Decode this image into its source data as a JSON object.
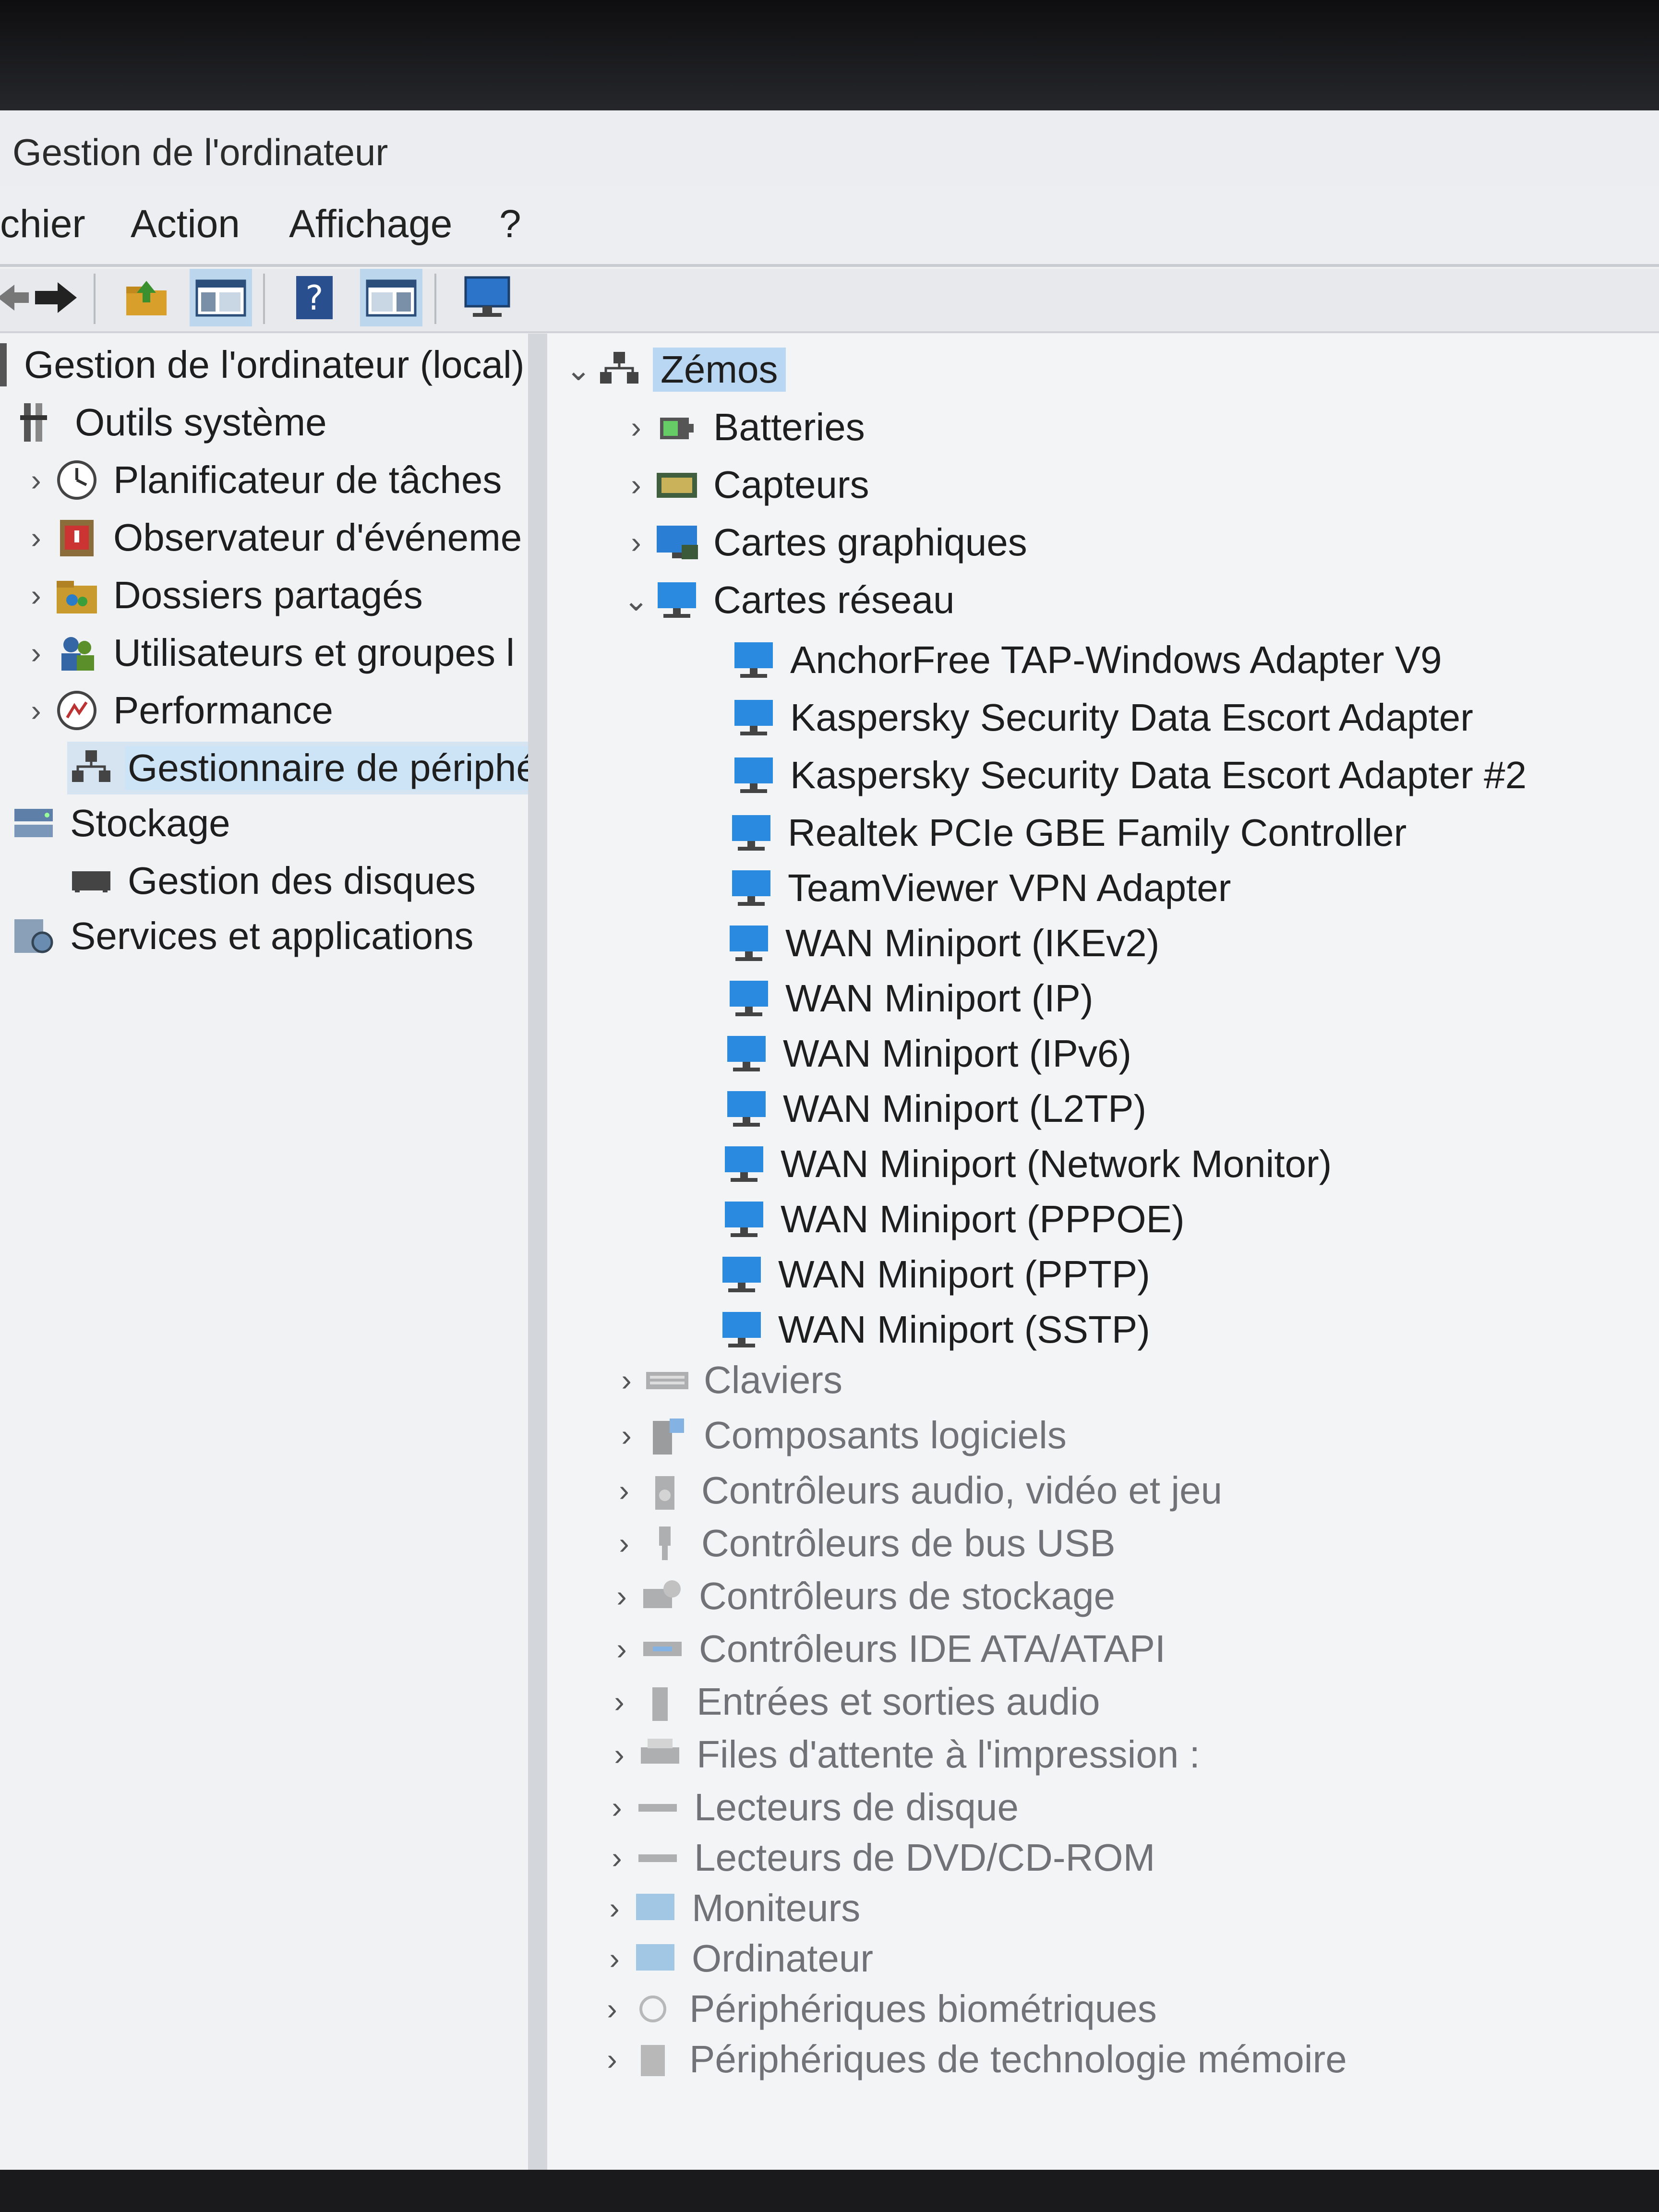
{
  "window": {
    "title": "Gestion de l'ordinateur"
  },
  "menu": [
    "chier",
    "Action",
    "Affichage",
    "?"
  ],
  "toolbar": {
    "buttons": [
      "back-arrow-icon",
      "forward-arrow-icon",
      "up-folder-icon",
      "show-console-tree-icon",
      "help-icon",
      "properties-pane-icon",
      "computer-icon"
    ]
  },
  "tree": {
    "root": "Gestion de l'ordinateur (local)",
    "system_tools": "Outils système",
    "items": [
      "Planificateur de tâches",
      "Observateur d'événeme",
      "Dossiers partagés",
      "Utilisateurs et groupes l",
      "Performance",
      "Gestionnaire de périphé"
    ],
    "storage": "Stockage",
    "disk_mgmt": "Gestion des disques",
    "services": "Services et applications"
  },
  "devices": {
    "root": "Zémos",
    "categories_top": [
      "Batteries",
      "Capteurs",
      "Cartes graphiques",
      "Cartes réseau"
    ],
    "network_adapters": [
      "AnchorFree TAP-Windows Adapter V9",
      "Kaspersky Security Data Escort Adapter",
      "Kaspersky Security Data Escort Adapter #2",
      "Realtek PCIe GBE Family Controller",
      "TeamViewer VPN Adapter",
      "WAN Miniport (IKEv2)",
      "WAN Miniport (IP)",
      "WAN Miniport (IPv6)",
      "WAN Miniport (L2TP)",
      "WAN Miniport (Network Monitor)",
      "WAN Miniport (PPPOE)",
      "WAN Miniport (PPTP)",
      "WAN Miniport (SSTP)"
    ],
    "categories_bottom": [
      "Claviers",
      "Composants logiciels",
      "Contrôleurs audio, vidéo et jeu",
      "Contrôleurs de bus USB",
      "Contrôleurs de stockage",
      "Contrôleurs IDE ATA/ATAPI",
      "Entrées et sorties audio",
      "Files d'attente à l'impression :",
      "Lecteurs de disque",
      "Lecteurs de DVD/CD-ROM",
      "Moniteurs",
      "Ordinateur",
      "Périphériques biométriques",
      "Périphériques de technologie mémoire"
    ]
  },
  "colors": {
    "accent": "#1e88e5",
    "selection": "#cde4f7"
  }
}
